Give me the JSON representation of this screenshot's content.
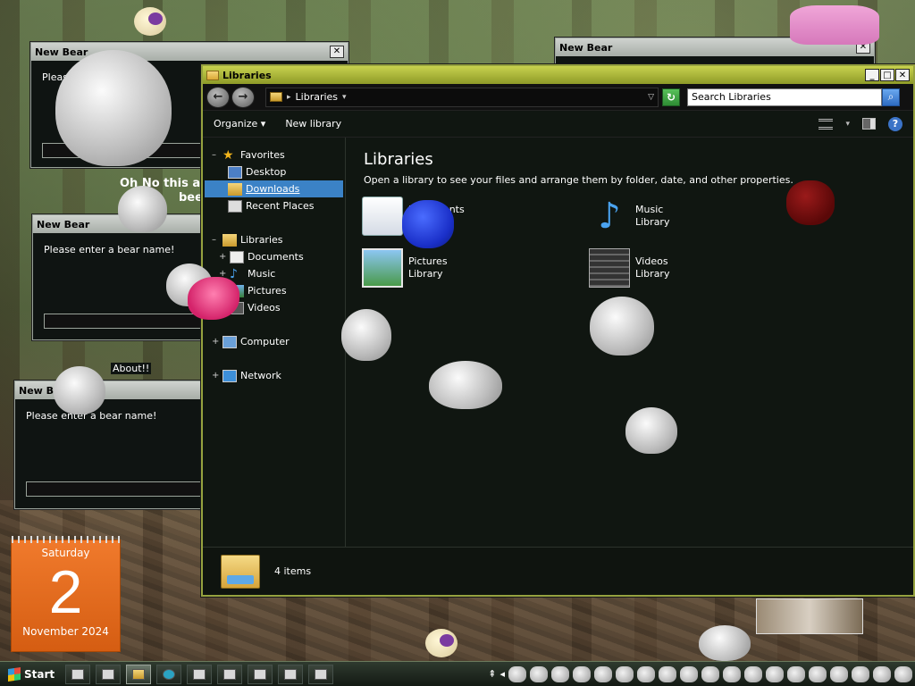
{
  "dialogs": [
    {
      "title": "New Bear",
      "prompt": "Please"
    },
    {
      "title": "New Bear",
      "prompt": "Please enter a bear name!"
    },
    {
      "title": "New Bear",
      "prompt": "Please enter a bear name!"
    },
    {
      "title": "New Bear",
      "prompt": ""
    }
  ],
  "floating_text": {
    "line1": "Oh No this ain",
    "line2": "bee",
    "about": "About!!"
  },
  "explorer": {
    "title": "Libraries",
    "address": "Libraries",
    "search_placeholder": "Search Libraries",
    "commands": {
      "organize": "Organize",
      "new_library": "New library"
    },
    "nav": {
      "favorites": "Favorites",
      "desktop": "Desktop",
      "downloads": "Downloads",
      "recent": "Recent Places",
      "libraries": "Libraries",
      "documents": "Documents",
      "music": "Music",
      "pictures": "Pictures",
      "videos": "Videos",
      "computer": "Computer",
      "network": "Network"
    },
    "heading": "Libraries",
    "subheading": "Open a library to see your files and arrange them by folder, date, and other properties.",
    "libraries": [
      {
        "name": "Documents",
        "kind": "Library"
      },
      {
        "name": "Music",
        "kind": "Library"
      },
      {
        "name": "Pictures",
        "kind": "Library"
      },
      {
        "name": "Videos",
        "kind": "Library"
      }
    ],
    "status": "4 items"
  },
  "calendar": {
    "weekday": "Saturday",
    "day": "2",
    "month_year": "November 2024"
  },
  "taskbar": {
    "start_label": "Start"
  },
  "colors": {
    "accent": "#96a23f",
    "selection": "#3b82c6",
    "calendar": "#e8691f"
  }
}
